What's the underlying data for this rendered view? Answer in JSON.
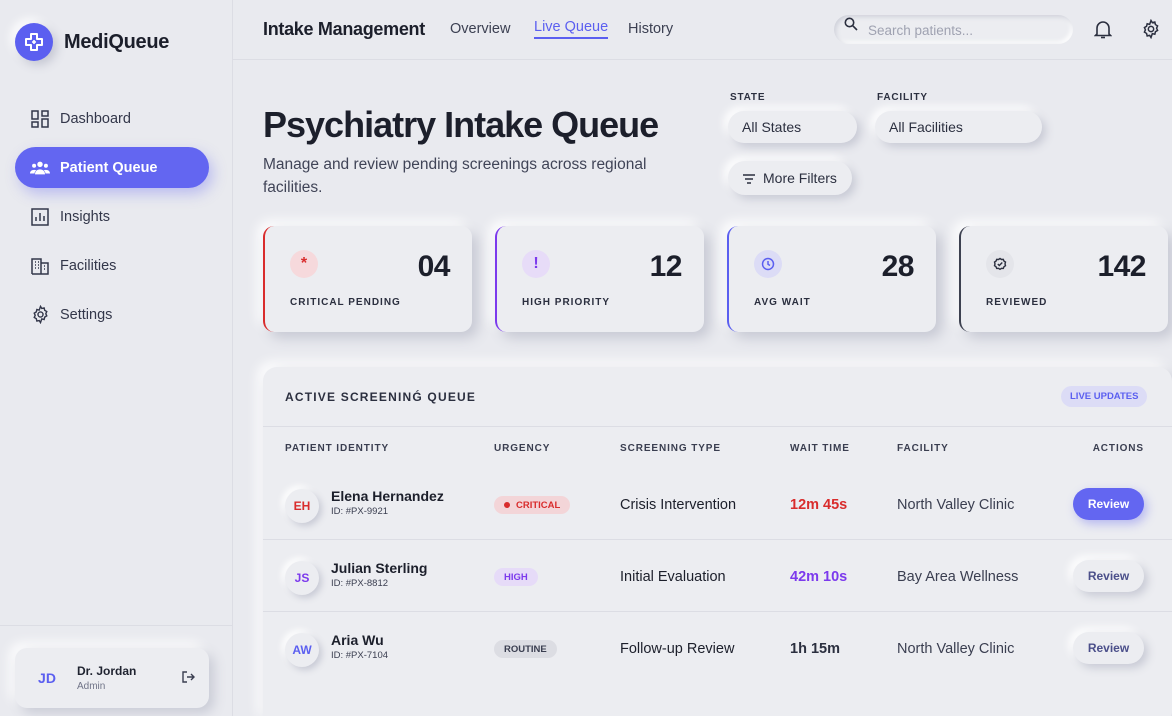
{
  "app": {
    "name": "MediQueue"
  },
  "sidebar": {
    "items": [
      {
        "label": "Dashboard",
        "icon": "dashboard-icon"
      },
      {
        "label": "Patient Queue",
        "icon": "users-icon"
      },
      {
        "label": "Insights",
        "icon": "chart-icon"
      },
      {
        "label": "Facilities",
        "icon": "building-icon"
      },
      {
        "label": "Settings",
        "icon": "gear-icon"
      }
    ],
    "active_index": 1,
    "user": {
      "initials": "JD",
      "name": "Dr. Jordan",
      "role": "Admin"
    }
  },
  "header": {
    "title": "Intake Management",
    "tabs": [
      {
        "label": "Overview"
      },
      {
        "label": "Live Queue"
      },
      {
        "label": "History"
      }
    ],
    "active_tab": 1,
    "search": {
      "placeholder": "Search patients...",
      "value": ""
    }
  },
  "page": {
    "title": "Psychiatry Intake Queue",
    "subtitle": "Manage and review pending screenings across regional facilities."
  },
  "filters": {
    "state": {
      "label": "STATE",
      "value": "All States"
    },
    "facility": {
      "label": "FACILITY",
      "value": "All Facilities"
    },
    "more": "More Filters"
  },
  "stats": [
    {
      "value": "04",
      "label": "CRITICAL PENDING",
      "color": "#d92c2c",
      "icon_bg": "#f6d9dc",
      "glyph": "*"
    },
    {
      "value": "12",
      "label": "HIGH PRIORITY",
      "color": "#7c3aed",
      "icon_bg": "#e7dcf8",
      "glyph": "!"
    },
    {
      "value": "28",
      "label": "AVG WAIT",
      "color": "#5b5ff0",
      "icon_bg": "#dcdcf6",
      "glyph": ""
    },
    {
      "value": "142",
      "label": "REVIEWED",
      "color": "#3d4150",
      "icon_bg": "#e4e5ea",
      "glyph": ""
    }
  ],
  "queue": {
    "title": "ACTIVE SCREENIΝǴ QUEUE",
    "live_badge": "LIVE UPDATES",
    "columns": [
      "PATIENT IDENTITY",
      "URGENCY",
      "SCREENING TYPE",
      "WAIT TIME",
      "FACILITY",
      "ACTIONS"
    ],
    "rows": [
      {
        "initials": "EH",
        "initials_color": "#d92c2c",
        "name": "Elena Hernandez",
        "id": "ID: #PX-9921",
        "urgency": "CRITICAL",
        "urgency_bg": "#f3d5d8",
        "urgency_color": "#d92c2c",
        "type": "Crisis Intervention",
        "wait": "12m 45s",
        "wait_color": "#d92c2c",
        "facility": "North Valley Clinic",
        "action": "Review",
        "action_style": "primary"
      },
      {
        "initials": "JS",
        "initials_color": "#7c3aed",
        "name": "Julian Sterling",
        "id": "ID: #PX-8812",
        "urgency": "HIGH",
        "urgency_bg": "#e6dbf8",
        "urgency_color": "#7c3aed",
        "type": "Initial Evaluation",
        "wait": "42m 10s",
        "wait_color": "#7c3aed",
        "facility": "Bay Area Wellness",
        "action": "Review",
        "action_style": "neutral"
      },
      {
        "initials": "AW",
        "initials_color": "#5b5ff0",
        "name": "Aria Wu",
        "id": "ID: #PX-7104",
        "urgency": "ROUTINE",
        "urgency_bg": "#dcdde3",
        "urgency_color": "#3a3e50",
        "type": "Follow-up Review",
        "wait": "1h 15m",
        "wait_color": "#2b2f3f",
        "facility": "North Valley Clinic",
        "action": "Review",
        "action_style": "neutral"
      }
    ]
  }
}
